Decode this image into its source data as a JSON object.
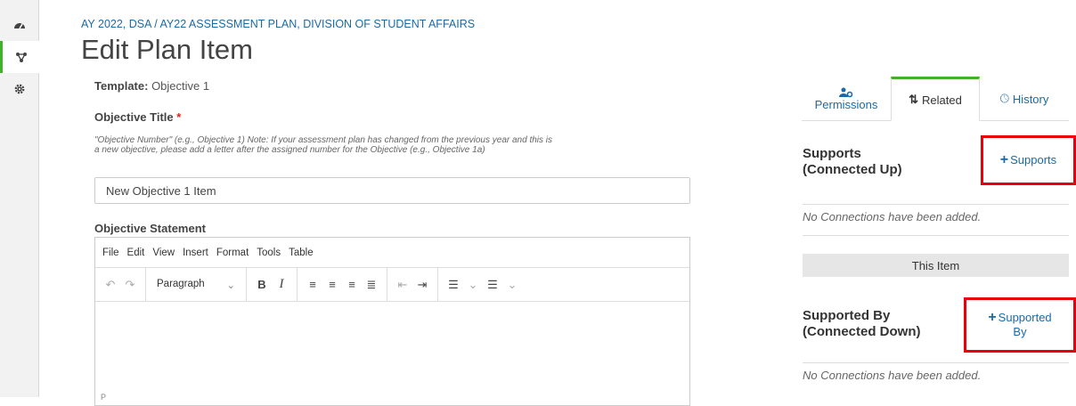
{
  "breadcrumb": "AY 2022, DSA / AY22 ASSESSMENT PLAN, DIVISION OF STUDENT AFFAIRS",
  "page_title": "Edit Plan Item",
  "template": {
    "label": "Template:",
    "value": "Objective 1"
  },
  "objective_title": {
    "label": "Objective Title",
    "required_mark": "*",
    "help": "\"Objective Number\" (e.g., Objective 1) Note: If your assessment plan has changed from the previous year and this is a new objective, please add a letter after the assigned number for the Objective (e.g., Objective 1a)",
    "value": "New Objective 1 Item"
  },
  "objective_statement": {
    "label": "Objective Statement",
    "menu": [
      "File",
      "Edit",
      "View",
      "Insert",
      "Format",
      "Tools",
      "Table"
    ],
    "block_format": "Paragraph",
    "status_path": "P"
  },
  "tabs": [
    {
      "label": "Permissions",
      "icon": "users-gear-icon"
    },
    {
      "label": "Related",
      "icon": "sort-arrows-icon"
    },
    {
      "label": "History",
      "icon": "clock-icon"
    }
  ],
  "supports": {
    "title_line1": "Supports",
    "title_line2": "(Connected Up)",
    "add_label": "Supports",
    "empty": "No Connections have been added."
  },
  "this_item": "This Item",
  "supported_by": {
    "title_line1": "Supported By",
    "title_line2": "(Connected Down)",
    "add_label_line1": "Supported",
    "add_label_line2": "By",
    "empty": "No Connections have been added."
  },
  "colors": {
    "accent_green": "#43b02a",
    "link_blue": "#1a6aa6",
    "highlight_red": "#e8000b"
  }
}
